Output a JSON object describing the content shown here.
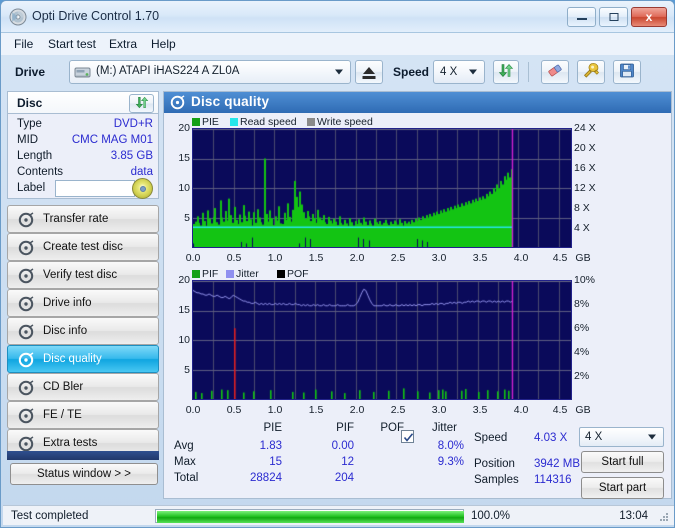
{
  "window": {
    "title": "Opti Drive Control 1.70",
    "app_icon": "disc-icon",
    "minimize_label": "",
    "maximize_label": "",
    "close_label": "x"
  },
  "menu": [
    {
      "label": "File"
    },
    {
      "label": "Start test"
    },
    {
      "label": "Extra"
    },
    {
      "label": "Help"
    }
  ],
  "toolbar": {
    "drive_label": "Drive",
    "drive_value": "(M:)  ATAPI iHAS224   A ZL0A",
    "eject_icon": "eject-icon",
    "speed_label": "Speed",
    "speed_value": "4 X",
    "refresh_icon": "refresh-icon",
    "erase_icon": "eraser-icon",
    "tools_icon": "wrench-icon",
    "save_icon": "save-disk-icon"
  },
  "disc_panel": {
    "header": "Disc",
    "refresh_icon": "refresh-icon",
    "rows": [
      {
        "key": "Type",
        "value": "DVD+R"
      },
      {
        "key": "MID",
        "value": "CMC MAG M01"
      },
      {
        "key": "Length",
        "value": "3.85 GB"
      },
      {
        "key": "Contents",
        "value": "data"
      }
    ],
    "label_key": "Label",
    "label_value": "",
    "label_placeholder": "",
    "label_disc_icon": "disc-icon"
  },
  "nav": {
    "items": [
      {
        "label": "Transfer rate",
        "icon": "disc-icon",
        "active": false
      },
      {
        "label": "Create test disc",
        "icon": "disc-icon",
        "active": false
      },
      {
        "label": "Verify test disc",
        "icon": "disc-icon",
        "active": false
      },
      {
        "label": "Drive info",
        "icon": "disc-icon",
        "active": false
      },
      {
        "label": "Disc info",
        "icon": "disc-icon",
        "active": false
      },
      {
        "label": "Disc quality",
        "icon": "disc-icon",
        "active": true
      },
      {
        "label": "CD Bler",
        "icon": "disc-icon",
        "active": false
      },
      {
        "label": "FE / TE",
        "icon": "disc-icon",
        "active": false
      },
      {
        "label": "Extra tests",
        "icon": "disc-icon",
        "active": false
      }
    ],
    "status_window_label": "Status window > >"
  },
  "main": {
    "header_title": "Disc quality",
    "header_icon": "disc-icon"
  },
  "chart_data": [
    {
      "type": "bar",
      "id": "pie-chart",
      "title": "",
      "xlabel": "GB",
      "ylabel": "",
      "ylim": [
        0,
        20
      ],
      "yticks": [
        "5",
        "10",
        "15",
        "20"
      ],
      "ytickvals": [
        5,
        10,
        15,
        20
      ],
      "y2lim": [
        0,
        24
      ],
      "y2ticks": [
        "4 X",
        "8 X",
        "12 X",
        "16 X",
        "20 X",
        "24 X"
      ],
      "y2tickvals": [
        4,
        8,
        12,
        16,
        20,
        24
      ],
      "xlim": [
        0,
        4.65
      ],
      "xticks": [
        "0.0",
        "0.5",
        "1.0",
        "1.5",
        "2.0",
        "2.5",
        "3.0",
        "3.5",
        "4.0",
        "4.5"
      ],
      "xtickvals": [
        0.0,
        0.5,
        1.0,
        1.5,
        2.0,
        2.5,
        3.0,
        3.5,
        4.0,
        4.5
      ],
      "x_unit": "GB",
      "grid": true,
      "legend": [
        {
          "label": "PIE",
          "color": "#16a116"
        },
        {
          "label": "Read speed",
          "color": "#26e6ea"
        },
        {
          "label": "Write speed",
          "color": "#8a8a8a"
        }
      ],
      "series": [
        {
          "name": "PIE",
          "color": "#13c413",
          "kind": "bar",
          "values": [
            3.9,
            4.3,
            5.2,
            4.1,
            3.6,
            5.8,
            4.4,
            3.5,
            6.2,
            4.8,
            4.0,
            5.1,
            6.6,
            4.2,
            3.8,
            7.9,
            5.0,
            4.3,
            6.1,
            4.5,
            8.2,
            5.4,
            4.1,
            6.8,
            4.6,
            3.9,
            5.5,
            4.2,
            7.1,
            5.3,
            4.4,
            6.0,
            4.7,
            3.6,
            5.9,
            4.1,
            6.4,
            5.0,
            4.2,
            3.8,
            15.0,
            5.6,
            4.3,
            6.2,
            4.9,
            3.7,
            5.2,
            4.5,
            6.9,
            4.0,
            3.9,
            5.8,
            4.6,
            7.4,
            5.1,
            4.3,
            6.3,
            11.2,
            8.5,
            6.8,
            9.4,
            7.2,
            5.9,
            4.8,
            6.1,
            5.2,
            4.4,
            5.6,
            4.9,
            4.1,
            6.3,
            5.0,
            4.6,
            5.4,
            4.2,
            3.9,
            5.1,
            4.5,
            4.0,
            4.8,
            4.3,
            3.7,
            5.2,
            4.1,
            3.8,
            4.6,
            4.0,
            3.5,
            4.9,
            4.2,
            3.6,
            4.4,
            3.9,
            4.7,
            4.1,
            3.8,
            5.0,
            4.3,
            3.7,
            4.5,
            4.0,
            3.6,
            4.8,
            4.2,
            3.9,
            4.4,
            3.8,
            4.1,
            4.6,
            4.0,
            3.7,
            4.3,
            3.9,
            4.5,
            4.2,
            3.8,
            4.7,
            4.1,
            3.6,
            4.4,
            4.0,
            4.3,
            3.9,
            4.6,
            4.2,
            4.8,
            4.4,
            5.0,
            4.6,
            5.2,
            4.8,
            5.4,
            5.0,
            5.6,
            5.2,
            5.8,
            5.4,
            6.0,
            5.6,
            6.2,
            5.8,
            6.4,
            6.0,
            6.6,
            6.2,
            6.8,
            6.4,
            7.0,
            6.6,
            7.2,
            6.8,
            7.4,
            7.0,
            7.6,
            7.2,
            7.8,
            7.4,
            8.0,
            7.6,
            8.2,
            7.8,
            8.4,
            8.0,
            8.6,
            8.2,
            9.0,
            8.6,
            9.4,
            9.0,
            10.0,
            9.4,
            10.6,
            10.0,
            11.2,
            10.6,
            12.0,
            11.4,
            12.6,
            11.8,
            13.2
          ]
        },
        {
          "name": "Read speed",
          "color": "#26e6ea",
          "kind": "line",
          "axis": "right",
          "constant_value": 4.03
        }
      ],
      "end_marker": {
        "x": 3.93,
        "color": "#d021d0",
        "label": ""
      }
    },
    {
      "type": "bar",
      "id": "pif-chart",
      "title": "",
      "xlabel": "GB",
      "ylabel": "",
      "ylim": [
        0,
        20
      ],
      "yticks": [
        "5",
        "10",
        "15",
        "20"
      ],
      "ytickvals": [
        5,
        10,
        15,
        20
      ],
      "y2lim": [
        0,
        10
      ],
      "y2ticks": [
        "2%",
        "4%",
        "6%",
        "8%",
        "10%"
      ],
      "y2tickvals": [
        2,
        4,
        6,
        8,
        10
      ],
      "xlim": [
        0,
        4.65
      ],
      "xticks": [
        "0.0",
        "0.5",
        "1.0",
        "1.5",
        "2.0",
        "2.5",
        "3.0",
        "3.5",
        "4.0",
        "4.5"
      ],
      "xtickvals": [
        0.0,
        0.5,
        1.0,
        1.5,
        2.0,
        2.5,
        3.0,
        3.5,
        4.0,
        4.5
      ],
      "x_unit": "GB",
      "grid": true,
      "legend": [
        {
          "label": "PIF",
          "color": "#16a116"
        },
        {
          "label": "Jitter",
          "color": "#9090f0"
        },
        {
          "label": "POF",
          "color": "#000000"
        }
      ],
      "series": [
        {
          "name": "PIF",
          "color": "#13c413",
          "kind": "bar",
          "spikes": [
            {
              "x": 0.03,
              "y": 1.2
            },
            {
              "x": 0.1,
              "y": 1.0
            },
            {
              "x": 0.22,
              "y": 1.4
            },
            {
              "x": 0.35,
              "y": 1.6
            },
            {
              "x": 0.42,
              "y": 1.5
            },
            {
              "x": 0.5,
              "y": 12.0,
              "color": "#e02020"
            },
            {
              "x": 0.62,
              "y": 1.1
            },
            {
              "x": 0.74,
              "y": 1.3
            },
            {
              "x": 0.95,
              "y": 1.5
            },
            {
              "x": 1.22,
              "y": 1.2
            },
            {
              "x": 1.35,
              "y": 1.1
            },
            {
              "x": 1.5,
              "y": 1.6
            },
            {
              "x": 1.7,
              "y": 1.3
            },
            {
              "x": 1.86,
              "y": 1.0
            },
            {
              "x": 2.04,
              "y": 1.5
            },
            {
              "x": 2.22,
              "y": 1.2
            },
            {
              "x": 2.4,
              "y": 1.4
            },
            {
              "x": 2.58,
              "y": 1.8
            },
            {
              "x": 2.75,
              "y": 1.3
            },
            {
              "x": 2.9,
              "y": 1.1
            },
            {
              "x": 3.02,
              "y": 1.5
            },
            {
              "x": 3.06,
              "y": 1.6
            },
            {
              "x": 3.1,
              "y": 1.3
            },
            {
              "x": 3.3,
              "y": 1.4
            },
            {
              "x": 3.34,
              "y": 1.7
            },
            {
              "x": 3.5,
              "y": 1.2
            },
            {
              "x": 3.62,
              "y": 1.5
            },
            {
              "x": 3.74,
              "y": 1.3
            },
            {
              "x": 3.82,
              "y": 1.6
            },
            {
              "x": 3.88,
              "y": 1.4
            }
          ]
        },
        {
          "name": "Jitter",
          "color": "#9595ef",
          "kind": "line",
          "axis": "right",
          "approx_values_pct": [
            9.2,
            9.1,
            9.0,
            9.0,
            8.9,
            8.9,
            8.8,
            8.8,
            8.9,
            8.8,
            8.7,
            8.7,
            8.8,
            8.7,
            8.6,
            8.6,
            8.7,
            8.6,
            8.5,
            8.6,
            8.8,
            8.7,
            8.6,
            8.5,
            8.4,
            8.3,
            8.3,
            8.2,
            8.2,
            8.1,
            8.1,
            8.2,
            8.1,
            8.0,
            8.1,
            8.0,
            8.1,
            8.0,
            8.1,
            8.0,
            8.0,
            8.1,
            8.0,
            8.1,
            8.0,
            8.1,
            8.0,
            8.0,
            8.1,
            8.0,
            8.0,
            8.1,
            8.0,
            8.0,
            7.9,
            8.0,
            7.9,
            8.0,
            7.9,
            7.9,
            8.0,
            7.9,
            8.0,
            7.9,
            7.9,
            8.0,
            7.9,
            7.9,
            8.0,
            7.9,
            7.9,
            7.9,
            8.0,
            7.9,
            7.9,
            7.9,
            7.9,
            8.0,
            7.9,
            7.9,
            7.9,
            8.0,
            8.2,
            8.6,
            9.0,
            9.3,
            9.2,
            8.8,
            8.4,
            8.1,
            7.9,
            7.9,
            7.9,
            7.9,
            7.9,
            8.0,
            7.9,
            7.9,
            8.0,
            7.9,
            7.9,
            8.0,
            7.9,
            7.9,
            8.0,
            7.9,
            8.0,
            7.9,
            8.0,
            7.9,
            8.0,
            7.9,
            8.0,
            8.0,
            7.9,
            8.0,
            8.0,
            8.0,
            8.0,
            8.1,
            8.0,
            8.1,
            8.0,
            8.1,
            8.1,
            8.0,
            8.1,
            8.1,
            8.2,
            8.1,
            8.2,
            8.1,
            8.2,
            8.2,
            8.1,
            8.2,
            8.2,
            8.3,
            8.2,
            8.3,
            8.2,
            8.3,
            8.3,
            8.2,
            8.3,
            8.3,
            8.2,
            8.3,
            8.3,
            8.2,
            8.3,
            8.2,
            8.3,
            8.2,
            8.3,
            8.2,
            8.3,
            8.3,
            8.2,
            8.3
          ],
          "avg_pct": 8.0,
          "max_pct": 9.3
        },
        {
          "name": "POF",
          "color": "#000000",
          "kind": "bar",
          "values": []
        }
      ],
      "end_marker": {
        "x": 3.93,
        "color": "#d021d0",
        "label": ""
      }
    }
  ],
  "stats": {
    "columns": [
      "PIE",
      "PIF",
      "POF",
      "Jitter"
    ],
    "jitter_checkbox_checked": true,
    "jitter_label": "Jitter",
    "rows": [
      {
        "label": "Avg",
        "pie": "1.83",
        "pif": "0.00",
        "pof": "",
        "jitter": "8.0%"
      },
      {
        "label": "Max",
        "pie": "15",
        "pif": "12",
        "pof": "",
        "jitter": "9.3%"
      },
      {
        "label": "Total",
        "pie": "28824",
        "pif": "204",
        "pof": "",
        "jitter": ""
      }
    ]
  },
  "readout": {
    "speed_label": "Speed",
    "speed_value": "4.03 X",
    "position_label": "Position",
    "position_value": "3942 MB",
    "samples_label": "Samples",
    "samples_value": "114316",
    "speed_select_value": "4 X",
    "start_full_label": "Start full",
    "start_part_label": "Start part"
  },
  "statusbar": {
    "text": "Test completed",
    "progress_pct_label": "100.0%",
    "progress_value": 100,
    "clock": "13:04"
  }
}
